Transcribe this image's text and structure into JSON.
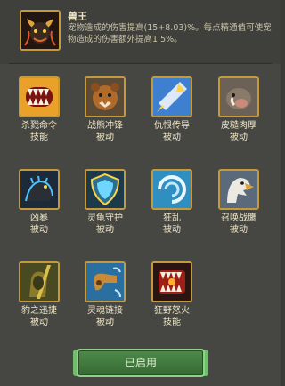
{
  "header": {
    "title": "兽王",
    "description": "宠物造成的伤害提高(15+8.03)%。每点精通值可使宠物造成的伤害额外提高1.5%。",
    "icon": "bull-demon-icon"
  },
  "skills": [
    {
      "name": "杀戮命令",
      "type": "技能",
      "icon": "fanged-maw-icon"
    },
    {
      "name": "战熊冲锋",
      "type": "被动",
      "icon": "war-bear-icon"
    },
    {
      "name": "仇恨传导",
      "type": "被动",
      "icon": "hatred-spear-icon"
    },
    {
      "name": "皮糙肉厚",
      "type": "被动",
      "icon": "boar-hide-icon"
    },
    {
      "name": "凶暴",
      "type": "被动",
      "icon": "ferocious-cat-icon"
    },
    {
      "name": "灵龟守护",
      "type": "被动",
      "icon": "turtle-shield-icon"
    },
    {
      "name": "狂乱",
      "type": "被动",
      "icon": "frenzy-swirl-icon"
    },
    {
      "name": "召唤战鹰",
      "type": "被动",
      "icon": "war-eagle-icon"
    },
    {
      "name": "豹之迅捷",
      "type": "被动",
      "icon": "leopard-swiftness-icon"
    },
    {
      "name": "灵魂链接",
      "type": "被动",
      "icon": "spirit-whistle-icon"
    },
    {
      "name": "狂野怒火",
      "type": "技能",
      "icon": "wild-fury-icon"
    }
  ],
  "button": {
    "label": "已启用"
  }
}
